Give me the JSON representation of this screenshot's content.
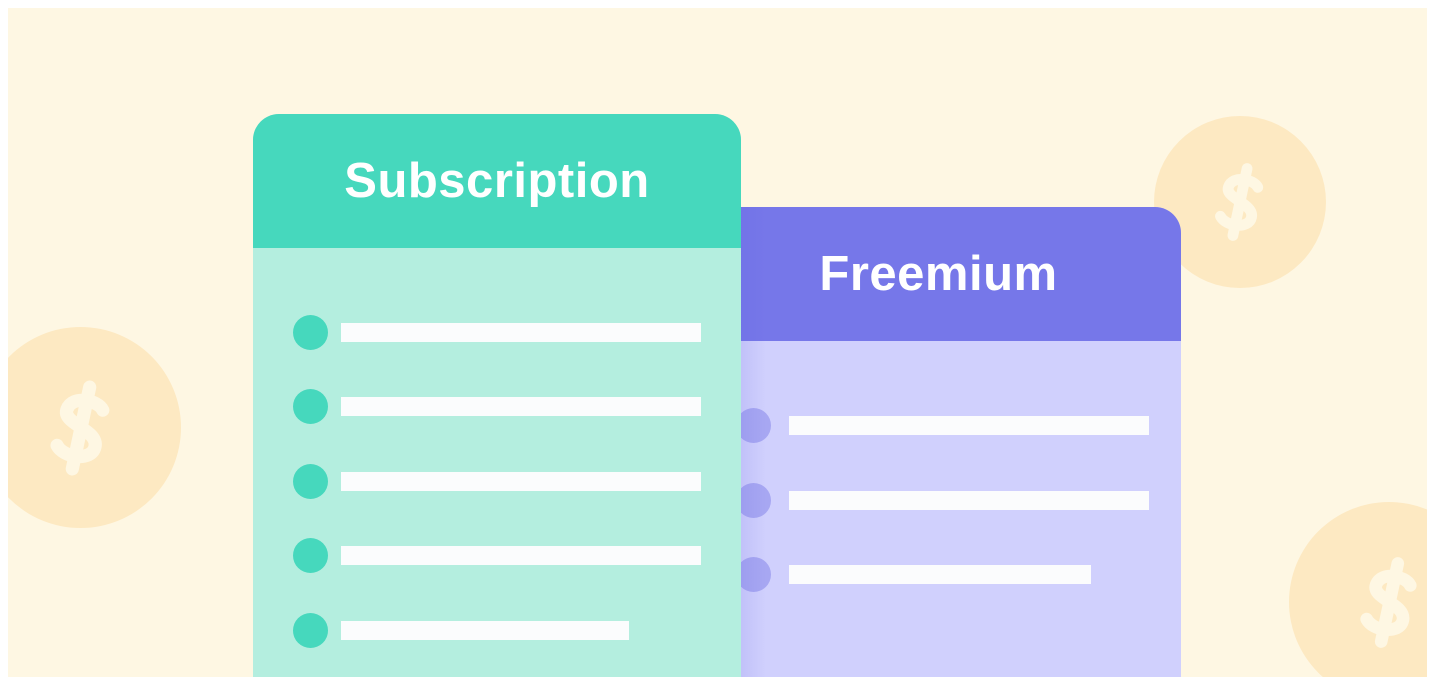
{
  "colors": {
    "background": "#fef7e3",
    "coin": "#fde9c2",
    "coin_symbol": "#fef7e3",
    "subscription_header": "#46d8bd",
    "subscription_body": "#b4eedf",
    "freemium_header": "#7677e9",
    "freemium_body": "#d0d0fd",
    "feature_line": "#fbfcfd"
  },
  "coins": [
    {
      "icon": "dollar-coin-icon",
      "symbol": "$"
    },
    {
      "icon": "dollar-coin-icon",
      "symbol": "$"
    },
    {
      "icon": "dollar-coin-icon",
      "symbol": "$"
    }
  ],
  "plans": {
    "subscription": {
      "title": "Subscription",
      "feature_count": 5,
      "bullet_icon": "circle-bullet-icon"
    },
    "freemium": {
      "title": "Freemium",
      "feature_count": 3,
      "bullet_icon": "circle-bullet-icon"
    }
  }
}
